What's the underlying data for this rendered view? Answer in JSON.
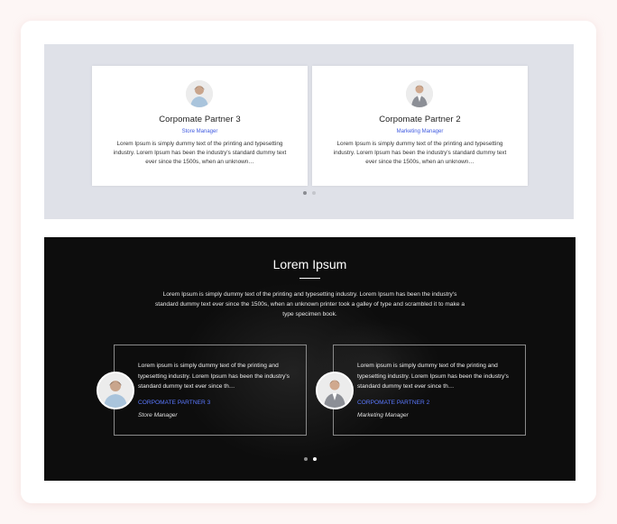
{
  "top_section": {
    "cards": [
      {
        "name": "Corpomate Partner 3",
        "role": "Store Manager",
        "text": "Lorem Ipsum is simply dummy text of the printing and typesetting industry. Lorem Ipsum has been the industry's standard dummy text ever since the 1500s, when an unknown…"
      },
      {
        "name": "Corpomate Partner 2",
        "role": "Marketing Manager",
        "text": "Lorem Ipsum is simply dummy text of the printing and typesetting industry. Lorem Ipsum has been the industry's standard dummy text ever since the 1500s, when an unknown…"
      }
    ]
  },
  "dark_section": {
    "title": "Lorem Ipsum",
    "intro": "Lorem Ipsum is simply dummy text of the printing and typesetting industry. Lorem Ipsum has been the industry's standard dummy text ever since the 1500s, when an unknown printer took a galley of type and scrambled it to make a type specimen book.",
    "cards": [
      {
        "text": "Lorem ipsum is simply dummy text of the printing and typesetting industry. Lorem Ipsum has been the industry's standard dummy text ever since th…",
        "name": "Corpomate Partner 3",
        "role": "Store Manager"
      },
      {
        "text": "Lorem ipsum is simply dummy text of the printing and typesetting industry. Lorem Ipsum has been the industry's standard dummy text ever since th…",
        "name": "Corpomate Partner 2",
        "role": "Marketing Manager"
      }
    ]
  },
  "colors": {
    "accent": "#3f5ae0",
    "accent_dark": "#5a78ff",
    "top_bg": "#dfe1e8",
    "dark_bg": "#0d0d0d"
  }
}
